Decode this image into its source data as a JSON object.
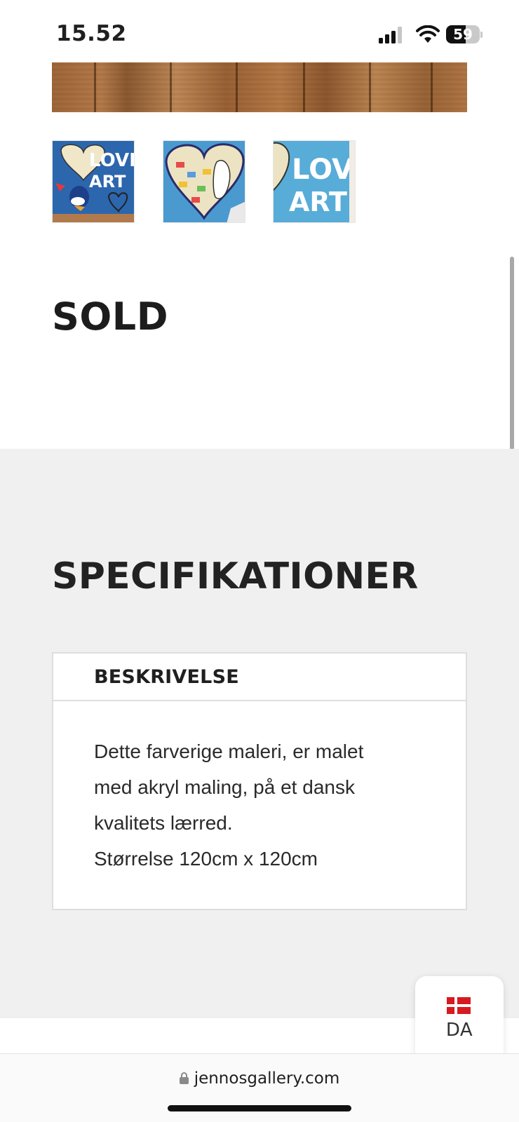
{
  "status_bar": {
    "time": "15.52",
    "battery_percent": "59",
    "battery_level": 0.59,
    "icons": [
      "signal-icon",
      "wifi-icon",
      "battery-icon"
    ]
  },
  "gallery": {
    "hero_image": "wooden-floor-photo",
    "thumbnails": [
      {
        "name": "love-art-painting-thumbnail"
      },
      {
        "name": "heart-detail-thumbnail"
      },
      {
        "name": "love-art-detail-thumbnail"
      }
    ]
  },
  "product": {
    "status": "SOLD"
  },
  "specs": {
    "title": "SPECIFIKATIONER",
    "accordion": {
      "header": "BESKRIVELSE",
      "lines": [
        "Dette farverige maleri, er malet",
        "med akryl maling, på et dansk",
        "kvalitets lærred.",
        "Størrelse 120cm x 120cm"
      ]
    }
  },
  "language_widget": {
    "code": "DA",
    "flag": "denmark-flag-icon",
    "colors": {
      "flag_red": "#d71920"
    }
  },
  "browser": {
    "url": "jennosgallery.com"
  }
}
